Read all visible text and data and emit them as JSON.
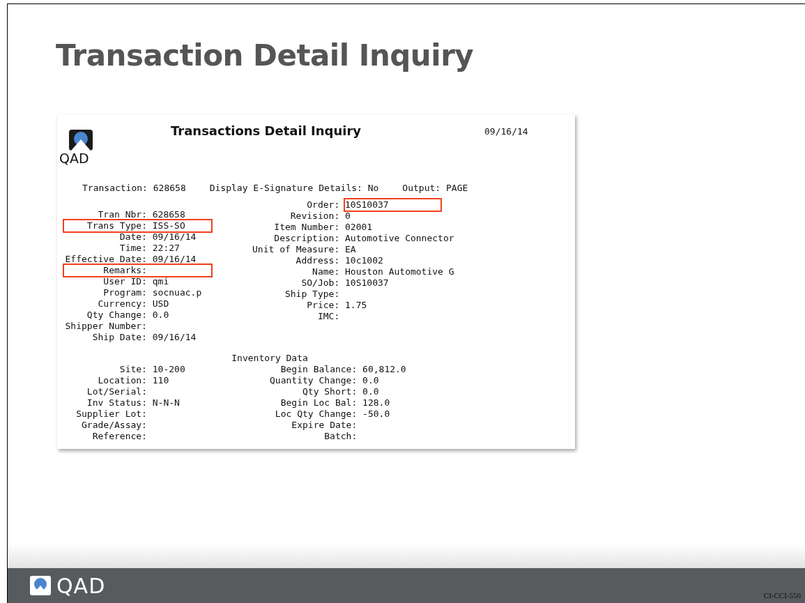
{
  "slide": {
    "title": "Transaction Detail Inquiry",
    "footer": {
      "logo_text": "QAD",
      "code": "CI-CCI-550"
    }
  },
  "report": {
    "logo_text": "QAD",
    "title": "Transactions Detail Inquiry",
    "date": "09/16/14",
    "header_line": [
      {
        "label": "Transaction:",
        "value": "628658"
      },
      {
        "label": "Display E-Signature Details:",
        "value": "No"
      },
      {
        "label": "Output:",
        "value": "PAGE"
      }
    ],
    "left_fields": [
      {
        "label": "Tran Nbr:",
        "value": "628658",
        "highlighted": false
      },
      {
        "label": "Trans Type:",
        "value": "ISS-SO",
        "highlighted": true
      },
      {
        "label": "Date:",
        "value": "09/16/14",
        "highlighted": false
      },
      {
        "label": "Time:",
        "value": "22:27",
        "highlighted": false
      },
      {
        "label": "Effective Date:",
        "value": "09/16/14",
        "highlighted": false
      },
      {
        "label": "Remarks:",
        "highlighted": true
      },
      {
        "label": "User ID:",
        "value": "qmi",
        "highlighted": false
      },
      {
        "label": "Program:",
        "value": "socnuac.p",
        "highlighted": false
      },
      {
        "label": "Currency:",
        "value": "USD",
        "highlighted": false
      },
      {
        "label": "Qty Change:",
        "value": "0.0",
        "highlighted": false
      },
      {
        "label": "Shipper Number:",
        "highlighted": false
      },
      {
        "label": "Ship Date:",
        "value": "09/16/14",
        "highlighted": false
      }
    ],
    "right_fields": [
      {
        "label": "Order:",
        "value": "10S10037",
        "highlighted": true
      },
      {
        "label": "Revision:",
        "value": "0",
        "highlighted": false
      },
      {
        "label": "Item Number:",
        "value": "02001",
        "highlighted": false
      },
      {
        "label": "Description:",
        "value": "Automotive Connector",
        "highlighted": false
      },
      {
        "label": "Unit of Measure:",
        "value": "EA",
        "highlighted": false
      },
      {
        "label": "Address:",
        "value": "10c1002",
        "highlighted": false
      },
      {
        "label": "Name:",
        "value": "Houston Automotive G",
        "highlighted": false
      },
      {
        "label": "SO/Job:",
        "value": "10S10037",
        "highlighted": false
      },
      {
        "label": "Ship Type:",
        "highlighted": false
      },
      {
        "label": "Price:",
        "value": "1.75",
        "highlighted": false
      },
      {
        "label": "IMC:",
        "highlighted": false
      }
    ],
    "inventory": {
      "heading": "Inventory Data",
      "left_fields": [
        {
          "label": "Site:",
          "value": "10-200"
        },
        {
          "label": "Location:",
          "value": "110"
        },
        {
          "label": "Lot/Serial:"
        },
        {
          "label": "Inv Status:",
          "value": "N-N-N"
        },
        {
          "label": "Supplier Lot:"
        },
        {
          "label": "Grade/Assay:"
        },
        {
          "label": "Reference:"
        }
      ],
      "right_fields": [
        {
          "label": "Begin Balance:",
          "value": "60,812.0"
        },
        {
          "label": "Quantity Change:",
          "value": "0.0"
        },
        {
          "label": "Qty Short:",
          "value": "0.0"
        },
        {
          "label": "Begin Loc Bal:",
          "value": "128.0"
        },
        {
          "label": "Loc Qty Change:",
          "value": "-50.0"
        },
        {
          "label": "Expire Date:"
        },
        {
          "label": "Batch:"
        }
      ]
    }
  }
}
